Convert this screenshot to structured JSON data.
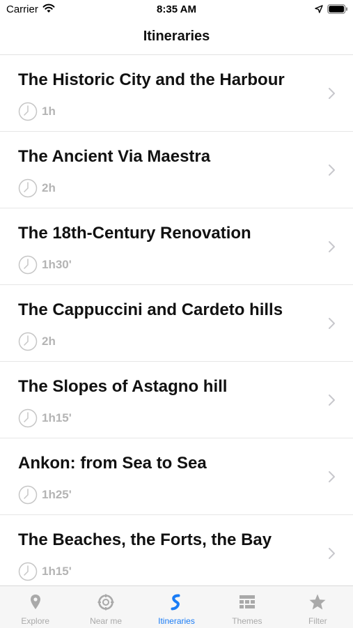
{
  "status_bar": {
    "carrier": "Carrier",
    "time": "8:35 AM",
    "icons": [
      "wifi-icon",
      "location-arrow-icon",
      "battery-icon"
    ]
  },
  "nav": {
    "title": "Itineraries"
  },
  "itineraries": [
    {
      "title": "The Historic City and the Harbour",
      "duration": "1h"
    },
    {
      "title": "The Ancient Via Maestra",
      "duration": "2h"
    },
    {
      "title": "The 18th-Century Renovation",
      "duration": "1h30'"
    },
    {
      "title": "The Cappuccini and Cardeto hills",
      "duration": "2h"
    },
    {
      "title": "The Slopes of Astagno hill",
      "duration": "1h15'"
    },
    {
      "title": "Ankon: from Sea to Sea",
      "duration": "1h25'"
    },
    {
      "title": "The Beaches, the Forts, the Bay",
      "duration": "1h15'"
    }
  ],
  "tabs": [
    {
      "label": "Explore",
      "icon": "map-pin-icon",
      "active": false
    },
    {
      "label": "Near me",
      "icon": "compass-icon",
      "active": false
    },
    {
      "label": "Itineraries",
      "icon": "route-icon",
      "active": true
    },
    {
      "label": "Themes",
      "icon": "grid-icon",
      "active": false
    },
    {
      "label": "Filter",
      "icon": "star-icon",
      "active": false
    }
  ],
  "colors": {
    "accent": "#1a7cf5",
    "inactive": "#a9a9a9",
    "duration_text": "#b4b4b4",
    "separator": "#e6e6e6"
  }
}
